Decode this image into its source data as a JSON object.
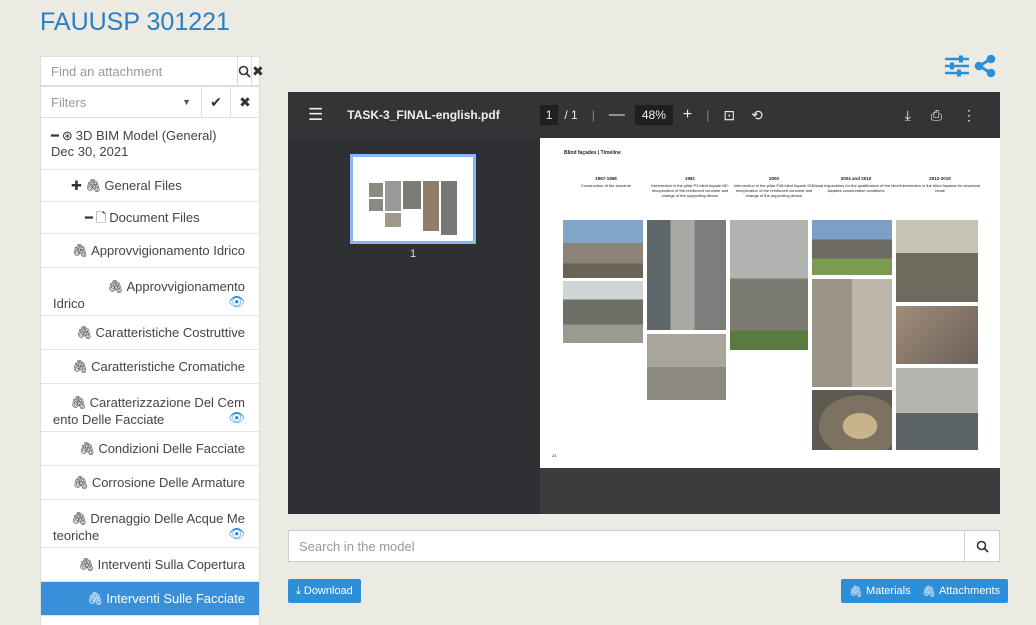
{
  "page_title": "FAUUSP 301221",
  "sidebar": {
    "search_placeholder": "Find an attachment",
    "filters_label": "Filters",
    "root": {
      "label": "3D BIM Model (General)",
      "date": "Dec 30, 2021"
    },
    "general_files": "General Files",
    "document_files": "Document Files",
    "files": [
      {
        "label": "Approvvigionamento Idrico"
      },
      {
        "l1": "Approvvigionamento",
        "l2": "Idrico"
      },
      {
        "label": "Caratteristiche Costruttive"
      },
      {
        "label": "Caratteristiche Cromatiche"
      },
      {
        "l1": "Caratterizzazione Del Cem",
        "l2": "ento Delle Facciate"
      },
      {
        "label": "Condizioni Delle Facciate"
      },
      {
        "label": "Corrosione Delle Armature"
      },
      {
        "l1": "Drenaggio Delle Acque Me",
        "l2": "teoriche"
      },
      {
        "label": "Interventi Sulla Copertura"
      },
      {
        "label": "Interventi Sulle Facciate"
      }
    ]
  },
  "viewer": {
    "filename": "TASK-3_FINAL-english.pdf",
    "page_current": "1",
    "page_total": "/ 1",
    "zoom": "48%",
    "thumb_number": "1",
    "page_heading": "Blind façades | Timeline",
    "timeline": [
      {
        "year": "1967-1968",
        "text": "Construction of the structure"
      },
      {
        "year": "1981",
        "text": "Intervention in the pillar P3 blind façade NE: recuperation of the reinforced concrete and change of the supporting device"
      },
      {
        "year": "2000",
        "text": "Intervention in the pillar P48 blind façade SO: recuperation of the reinforced concrete and change of the supporting device"
      },
      {
        "year": "2004 and 2010",
        "text": "Visual inspections for the qualification of the blind façades conservation conditions"
      },
      {
        "year": "2012-2015",
        "text": "Intervention in the blind façades for structural reuse"
      }
    ],
    "page_footer_num": "24"
  },
  "model_search_placeholder": "Search in the model",
  "buttons": {
    "download": "Download",
    "materials": "Materials",
    "attachments": "Attachments"
  },
  "colors": {
    "accent": "#2e8fd9",
    "title": "#2a7ec1",
    "active_row": "#3a8fd9"
  }
}
